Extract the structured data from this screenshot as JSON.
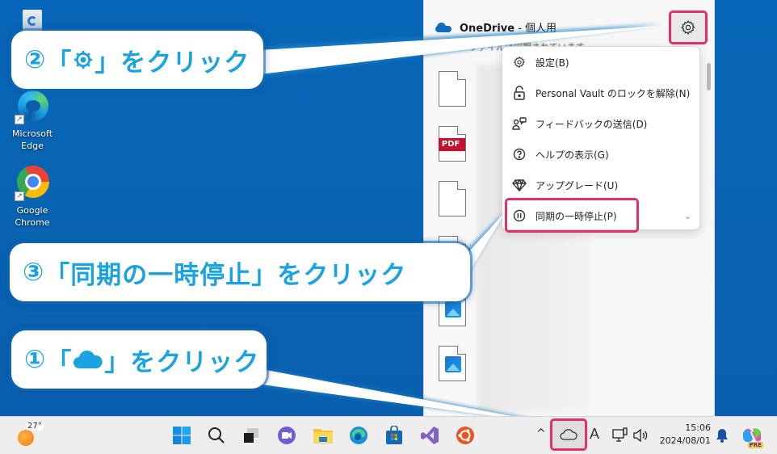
{
  "desktop": {
    "icons": [
      {
        "name": "recycle-bin",
        "label": ""
      },
      {
        "name": "microsoft-edge",
        "label_line1": "Microsoft",
        "label_line2": "Edge"
      },
      {
        "name": "google-chrome",
        "label_line1": "Google",
        "label_line2": "Chrome"
      }
    ]
  },
  "onedrive": {
    "title": "OneDrive",
    "title_suffix": " - 個人用",
    "subtitle": "ファイルは同期されています",
    "files": [
      {
        "type": "document"
      },
      {
        "type": "pdf",
        "tag": "PDF"
      },
      {
        "type": "document"
      },
      {
        "type": "image"
      },
      {
        "type": "image"
      },
      {
        "type": "image"
      }
    ]
  },
  "menu": {
    "items": [
      {
        "icon": "gear-icon",
        "label": "設定(B)"
      },
      {
        "icon": "unlock-icon",
        "label": "Personal Vault のロックを解除(N)"
      },
      {
        "icon": "feedback-icon",
        "label": "フィードバックの送信(D)"
      },
      {
        "icon": "help-icon",
        "label": "ヘルプの表示(G)"
      },
      {
        "icon": "diamond-icon",
        "label": "アップグレード(U)"
      },
      {
        "icon": "pause-icon",
        "label": "同期の一時停止(P)"
      }
    ],
    "pause_chevron": "⌄"
  },
  "callouts": {
    "step1": {
      "num": "①",
      "open": "「",
      "close": "」",
      "text": "をクリック",
      "icon": "cloud-icon"
    },
    "step2": {
      "num": "②",
      "open": "「",
      "close": "」",
      "text": "をクリック",
      "icon": "gear-icon"
    },
    "step3": {
      "num": "③",
      "open": "「",
      "close": "」",
      "text": "をクリック",
      "target": "同期の一時停止"
    }
  },
  "taskbar": {
    "weather_temp": "27°",
    "apps": [
      "start",
      "search",
      "task-view",
      "teams-chat",
      "file-explorer",
      "edge",
      "store",
      "visual-studio",
      "ubuntu"
    ],
    "tray": {
      "chevron": "^",
      "ime": "A",
      "time": "15:06",
      "date": "2024/08/01",
      "copilot_badge": "PRE"
    }
  },
  "colors": {
    "desktop": "#0761b2",
    "highlight": "#e3306b",
    "callout_text": "#1aa3e0",
    "pdf_red": "#c8102e"
  }
}
